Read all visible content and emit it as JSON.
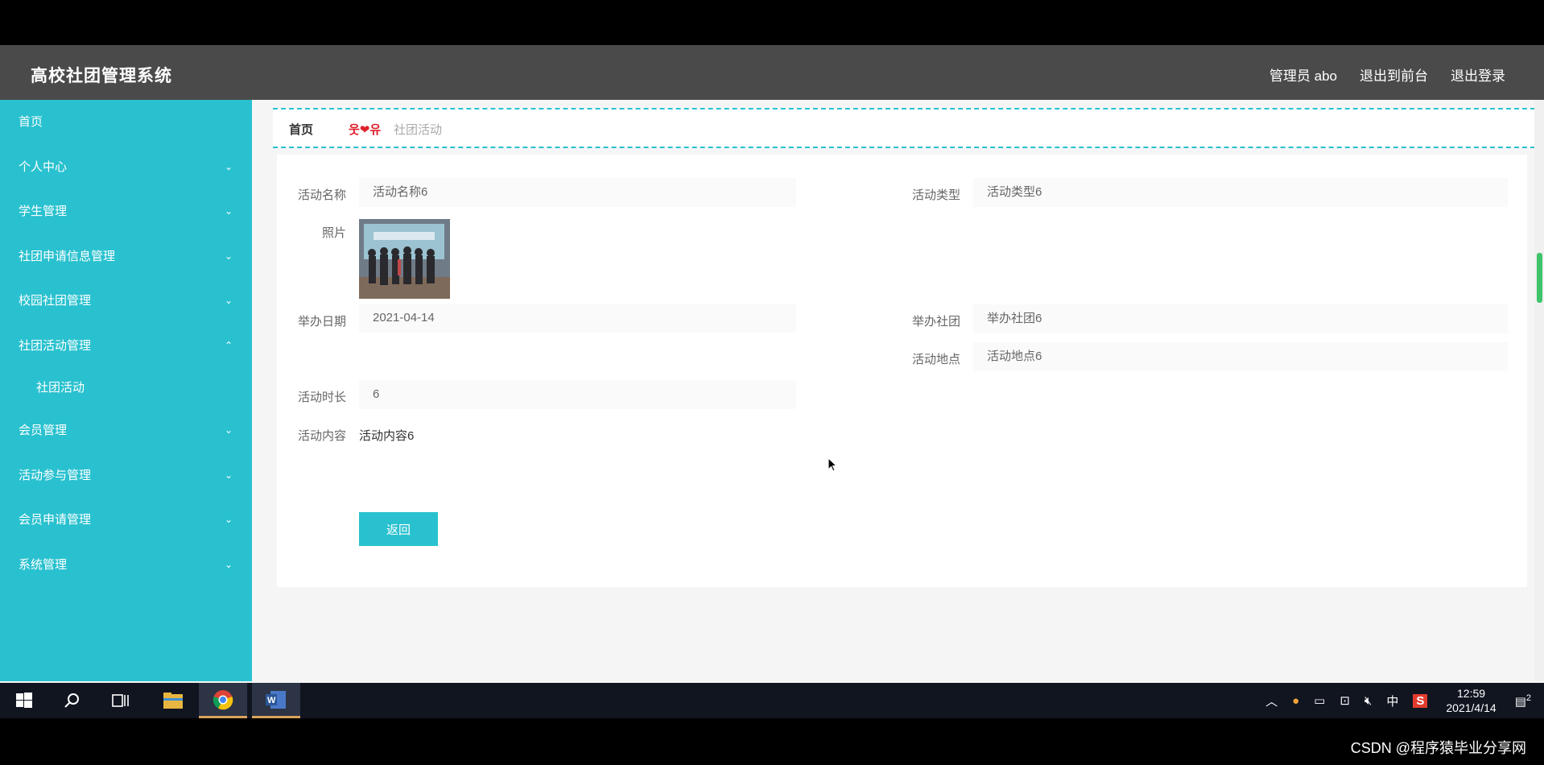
{
  "app": {
    "title": "高校社团管理系统",
    "user_label": "管理员 abo",
    "exit_front_label": "退出到前台",
    "logout_label": "退出登录"
  },
  "sidebar": {
    "items": [
      {
        "label": "首页"
      },
      {
        "label": "个人中心"
      },
      {
        "label": "学生管理"
      },
      {
        "label": "社团申请信息管理"
      },
      {
        "label": "校园社团管理"
      },
      {
        "label": "社团活动管理"
      },
      {
        "label": "会员管理"
      },
      {
        "label": "活动参与管理"
      },
      {
        "label": "会员申请管理"
      },
      {
        "label": "系统管理"
      }
    ],
    "sub_item": "社团活动"
  },
  "breadcrumb": {
    "home": "首页",
    "separator": "웃❤유",
    "current": "社团活动"
  },
  "form": {
    "activity_name_label": "活动名称",
    "activity_name_value": "活动名称6",
    "activity_type_label": "活动类型",
    "activity_type_value": "活动类型6",
    "photo_label": "照片",
    "date_label": "举办日期",
    "date_value": "2021-04-14",
    "club_label": "举办社团",
    "club_value": "举办社团6",
    "location_label": "活动地点",
    "location_value": "活动地点6",
    "duration_label": "活动时长",
    "duration_value": "6",
    "content_label": "活动内容",
    "content_value": "活动内容6",
    "back_button": "返回"
  },
  "taskbar": {
    "ime": "中",
    "time": "12:59",
    "date": "2021/4/14",
    "notification_count": "2"
  },
  "watermark": "CSDN @程序猿毕业分享网",
  "colors": {
    "accent": "#29c1cf",
    "topbar": "#4a4a4a",
    "separator": "#e0202a"
  }
}
